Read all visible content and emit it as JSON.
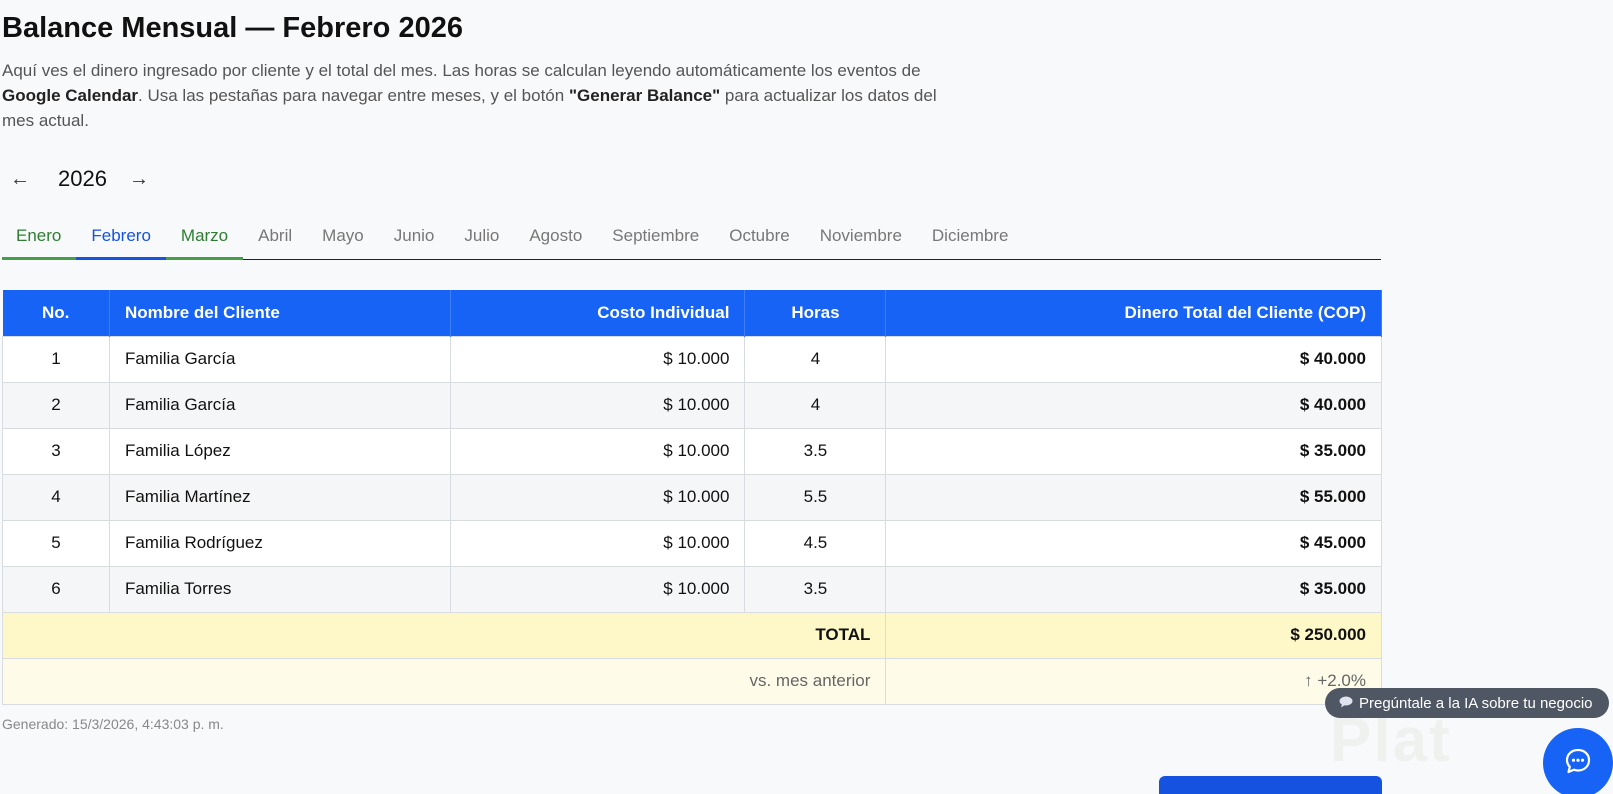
{
  "page": {
    "title": "Balance Mensual — Febrero 2026",
    "intro_1": "Aquí ves el dinero ingresado por cliente y el total del mes. Las horas se calculan leyendo automáticamente los eventos de ",
    "intro_bold_1": "Google Calendar",
    "intro_2": ". Usa las pestañas para navegar entre meses, y el botón ",
    "intro_bold_2": "\"Generar Balance\"",
    "intro_3": " para actualizar los datos del mes actual."
  },
  "year_nav": {
    "prev": "←",
    "year": "2026",
    "next": "→"
  },
  "tabs": [
    "Enero",
    "Febrero",
    "Marzo",
    "Abril",
    "Mayo",
    "Junio",
    "Julio",
    "Agosto",
    "Septiembre",
    "Octubre",
    "Noviembre",
    "Diciembre"
  ],
  "table": {
    "headers": [
      "No.",
      "Nombre del Cliente",
      "Costo Individual",
      "Horas",
      "Dinero Total del Cliente (COP)"
    ],
    "rows": [
      [
        "1",
        "Familia García",
        "$ 10.000",
        "4",
        "$ 40.000"
      ],
      [
        "2",
        "Familia García",
        "$ 10.000",
        "4",
        "$ 40.000"
      ],
      [
        "3",
        "Familia López",
        "$ 10.000",
        "3.5",
        "$ 35.000"
      ],
      [
        "4",
        "Familia Martínez",
        "$ 10.000",
        "5.5",
        "$ 55.000"
      ],
      [
        "5",
        "Familia Rodríguez",
        "$ 10.000",
        "4.5",
        "$ 45.000"
      ],
      [
        "6",
        "Familia Torres",
        "$ 10.000",
        "3.5",
        "$ 35.000"
      ]
    ],
    "total_label": "TOTAL",
    "total_value": "$ 250.000",
    "compare_label": "vs. mes anterior",
    "compare_value": "↑ +2.0%"
  },
  "generated": "Generado: 15/3/2026, 4:43:03 p. m.",
  "ai_pill": {
    "icon": "chat-bubble-icon",
    "label": "Pregúntale a la IA sobre tu negocio"
  },
  "watermark": "Plat",
  "colors": {
    "primary": "#1763f5",
    "done_tab": "#2e7d32",
    "total_bg": "#fef8c8",
    "up": "#1a9b3a"
  }
}
